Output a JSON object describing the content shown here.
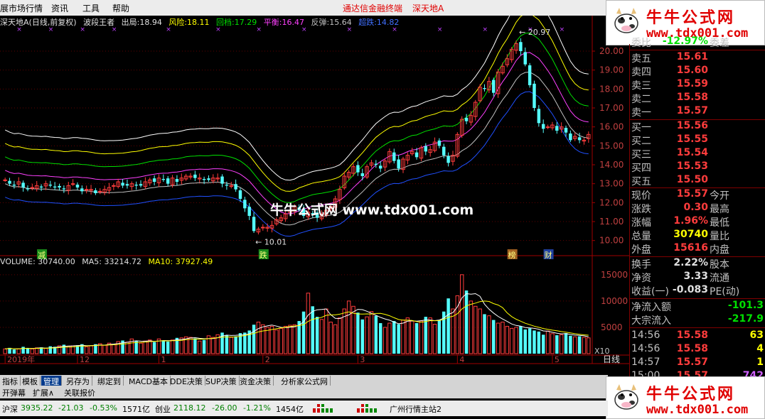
{
  "menubar": {
    "items": [
      "展市场行情",
      "资讯",
      "工具",
      "帮助"
    ],
    "promo": "通达信金融终端",
    "stock_title": "深天地A"
  },
  "logo": {
    "title": "牛牛公式网",
    "url": "www.tdx001.com"
  },
  "main_info": {
    "stock": "深天地A(日线,前复权)",
    "indicator": "波段王者",
    "out_label": "出局:",
    "out_value": "18.94",
    "risk_label": "风险:",
    "risk_value": "18.11",
    "pullback_label": "回档:",
    "pullback_value": "17.29",
    "balance_label": "平衡:",
    "balance_value": "16.47",
    "rebound_label": "反弹:",
    "rebound_value": "15.64",
    "ultra_label": "超跌:",
    "ultra_value": "14.82"
  },
  "vol_info": {
    "volume_label": "VOLUME:",
    "volume_value": "30740.00",
    "ma5_label": "MA5:",
    "ma5_value": "33214.72",
    "ma10_label": "MA10:",
    "ma10_value": "37927.49"
  },
  "price_axis": [
    "20.00",
    "19.00",
    "18.00",
    "17.00",
    "16.00",
    "15.00",
    "14.00",
    "13.00",
    "12.00",
    "11.00",
    "10.00"
  ],
  "vol_axis": [
    "15000",
    "10000",
    "5000"
  ],
  "vol_unit": "X10",
  "date_axis": [
    "2019年",
    "12",
    "1",
    "2",
    "3",
    "4",
    "5"
  ],
  "period_label": "日线",
  "annotations": {
    "high": "20.97",
    "low": "10.01",
    "markers": [
      "减",
      "跌",
      "榜",
      "财"
    ]
  },
  "watermark": "牛牛公式网 www.tdx001.com",
  "quote": {
    "weibi_label": "委比",
    "weibi_value": "-12.97%",
    "weicha_label": "委差",
    "sell": [
      {
        "label": "卖五",
        "price": "15.61"
      },
      {
        "label": "卖四",
        "price": "15.60"
      },
      {
        "label": "卖三",
        "price": "15.59"
      },
      {
        "label": "卖二",
        "price": "15.58"
      },
      {
        "label": "卖一",
        "price": "15.57"
      }
    ],
    "buy": [
      {
        "label": "买一",
        "price": "15.56"
      },
      {
        "label": "买二",
        "price": "15.55"
      },
      {
        "label": "买三",
        "price": "15.54"
      },
      {
        "label": "买四",
        "price": "15.53"
      },
      {
        "label": "买五",
        "price": "15.50"
      }
    ],
    "stats": [
      {
        "l1": "现价",
        "v1": "15.57",
        "l2": "今开",
        "v2": ""
      },
      {
        "l1": "涨跌",
        "v1": "0.30",
        "l2": "最高",
        "v2": ""
      },
      {
        "l1": "涨幅",
        "v1": "1.96%",
        "l2": "最低",
        "v2": ""
      },
      {
        "l1": "总量",
        "v1": "30740",
        "l2": "量比",
        "v2": ""
      },
      {
        "l1": "外盘",
        "v1": "15616",
        "l2": "内盘",
        "v2": ""
      }
    ],
    "stats2": [
      {
        "l1": "换手",
        "v1": "2.22%",
        "l2": "股本",
        "v2": ""
      },
      {
        "l1": "净资",
        "v1": "3.33",
        "l2": "流通",
        "v2": ""
      },
      {
        "l1": "收益(一)",
        "v1": "-0.083",
        "l2": "PE(动)",
        "v2": ""
      }
    ],
    "netflow_label": "净流入额",
    "netflow_value": "-101.3",
    "block_label": "大宗流入",
    "block_value": "-217.9",
    "ticks": [
      {
        "time": "14:56",
        "price": "15.58",
        "vol": "63"
      },
      {
        "time": "14:56",
        "price": "15.58",
        "vol": "4"
      },
      {
        "time": "14:57",
        "price": "15.57",
        "vol": "1"
      },
      {
        "time": "15:00",
        "price": "15.57",
        "vol": "742"
      }
    ]
  },
  "tabs": [
    "指标",
    "模板",
    "管理",
    "另存为",
    "绑定到",
    "MACD基本",
    "DDE决策",
    "SUP决策",
    "资金决策",
    "分析家公式网"
  ],
  "active_tab": "管理",
  "subtabs": [
    "开弹幕",
    "扩展∧",
    "关联报价"
  ],
  "status": {
    "sh_label": "沪深",
    "sh_value": "3935.22",
    "sh_change": "-21.03",
    "sh_pct": "-0.53%",
    "sh_amount": "1571亿",
    "cy_label": "创业",
    "cy_value": "2118.12",
    "cy_change": "-26.00",
    "cy_pct": "-1.21%",
    "cy_amount": "1454亿",
    "server": "广州行情主站2"
  },
  "colors": {
    "up": "#ff3c3c",
    "down": "#54ffff",
    "out": "#ffffff",
    "risk": "#ffff00",
    "pullback": "#00e000",
    "balance": "#ff40ff",
    "rebound": "#c0c0c0",
    "ultra": "#2050ff"
  },
  "chart_data": {
    "type": "candlestick",
    "ylim": [
      9.5,
      21.5
    ],
    "vol_ylim": [
      0,
      17000
    ],
    "closes": [
      13.2,
      13.0,
      12.9,
      13.1,
      12.8,
      12.7,
      12.8,
      12.9,
      12.8,
      13.0,
      12.9,
      12.8,
      12.8,
      12.7,
      12.9,
      13.0,
      12.8,
      12.6,
      12.7,
      12.7,
      12.5,
      12.6,
      12.7,
      12.8,
      12.9,
      13.1,
      12.9,
      12.9,
      13.0,
      12.9,
      12.9,
      13.1,
      13.2,
      13.1,
      13.3,
      13.2,
      13.0,
      13.3,
      13.1,
      13.3,
      13.4,
      13.4,
      13.3,
      13.3,
      13.2,
      13.2,
      13.3,
      13.3,
      13.0,
      12.9,
      12.9,
      12.7,
      12.2,
      11.7,
      11.3,
      10.5,
      10.6,
      10.7,
      10.7,
      10.8,
      11.1,
      11.2,
      11.4,
      11.6,
      11.8,
      11.6,
      11.3,
      11.5,
      11.4,
      11.2,
      11.4,
      11.6,
      11.8,
      12.2,
      12.7,
      13.4,
      13.6,
      13.9,
      13.6,
      13.4,
      13.9,
      14.1,
      14.0,
      13.8,
      14.2,
      14.7,
      14.2,
      13.8,
      14.3,
      14.5,
      14.7,
      14.4,
      14.9,
      14.7,
      14.8,
      15.2,
      15.0,
      14.5,
      14.1,
      14.5,
      15.6,
      16.4,
      16.3,
      16.6,
      17.3,
      18.1,
      18.0,
      18.4,
      17.8,
      18.9,
      19.2,
      19.6,
      20.1,
      20.4,
      20.0,
      19.3,
      18.2,
      17.0,
      16.2,
      15.9,
      16.0,
      16.1,
      15.8,
      16.0,
      15.7,
      15.3,
      15.5,
      15.3,
      15.3,
      15.6
    ],
    "volumes": [
      900,
      1100,
      800,
      900,
      1300,
      1000,
      900,
      1100,
      1200,
      1000,
      1400,
      1300,
      1500,
      1700,
      1400,
      1500,
      1600,
      1800,
      1300,
      1500,
      1800,
      1900,
      1600,
      2000,
      1800,
      2300,
      2500,
      2200,
      2800,
      2400,
      2000,
      2400,
      2600,
      2200,
      2800,
      2500,
      2300,
      2600,
      3000,
      3000,
      3200,
      3100,
      2900,
      2400,
      2600,
      3400,
      3100,
      3600,
      4000,
      3500,
      3100,
      3300,
      3900,
      4000,
      4400,
      5500,
      6000,
      5500,
      5000,
      5200,
      4500,
      4800,
      5200,
      5400,
      5500,
      6200,
      8000,
      11500,
      9000,
      7000,
      6500,
      8500,
      6000,
      5500,
      6800,
      8500,
      10000,
      9000,
      7800,
      6500,
      7000,
      8000,
      7200,
      5800,
      5000,
      5800,
      6200,
      5600,
      6400,
      6800,
      6200,
      5800,
      6200,
      7000,
      6800,
      5600,
      6400,
      8000,
      10500,
      8500,
      11000,
      15000,
      12000,
      10000,
      9000,
      8500,
      7500,
      7200,
      6400,
      5800,
      6000,
      5200,
      4800,
      5000,
      5200,
      4600,
      4800,
      4400,
      4200,
      3600,
      4300,
      3800,
      3500,
      3600,
      3900,
      3400,
      3200,
      3300,
      3100,
      3000
    ],
    "dates_tick_index": [
      0,
      16,
      34,
      57,
      78,
      100,
      121
    ]
  }
}
